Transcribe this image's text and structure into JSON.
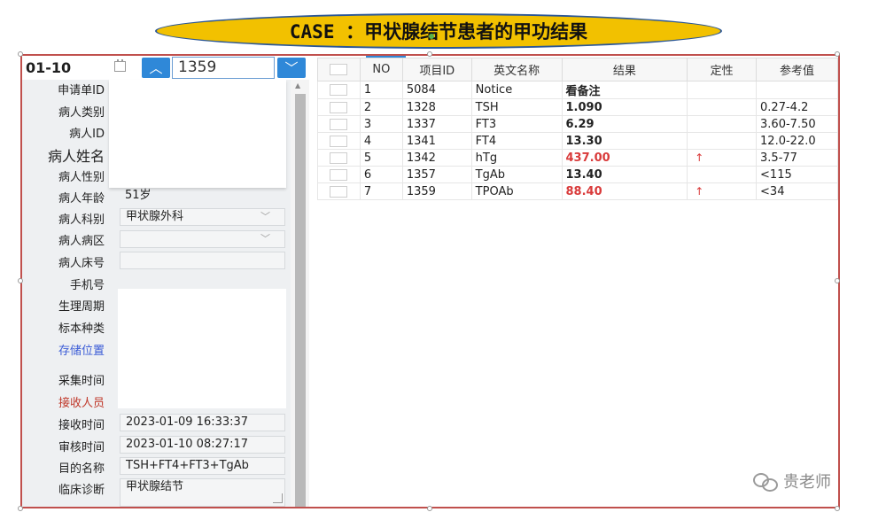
{
  "banner": {
    "title": "CASE ：甲状腺结节患者的甲功结果"
  },
  "toolbar": {
    "sample_no": "01-10",
    "calendar_icon": "calendar-icon",
    "up_icon": "chevron-up-icon",
    "down_icon": "chevron-down-icon",
    "search_value": "1359"
  },
  "patient": {
    "labels": {
      "request_id": "申请单ID",
      "patient_type": "病人类别",
      "patient_id": "病人ID",
      "patient_name": "病人姓名",
      "gender": "病人性别",
      "age": "病人年龄",
      "department": "病人科别",
      "ward": "病人病区",
      "bed": "病人床号",
      "phone": "手机号",
      "cycle": "生理周期",
      "specimen": "标本种类",
      "storage": "存储位置",
      "collect_time": "采集时间",
      "receiver": "接收人员",
      "receive_time": "接收时间",
      "audit_time": "审核时间",
      "purpose": "目的名称",
      "diagnosis": "临床诊断"
    },
    "values": {
      "age": "51岁",
      "department": "甲状腺外科",
      "ward": "",
      "bed": "",
      "receive_time": "2023-01-09 16:33:37",
      "audit_time": "2023-01-10 08:27:17",
      "purpose": "TSH+FT4+FT3+TgAb",
      "diagnosis": "甲状腺结节"
    }
  },
  "results": {
    "headers": [
      "NO",
      "项目ID",
      "英文名称",
      "结果",
      "定性",
      "参考值"
    ],
    "rows": [
      {
        "no": "1",
        "item_id": "5084",
        "name": "Notice",
        "result": "看备注",
        "flag": "",
        "ref": "",
        "high": false
      },
      {
        "no": "2",
        "item_id": "1328",
        "name": "TSH",
        "result": "1.090",
        "flag": "",
        "ref": "0.27-4.2",
        "high": false
      },
      {
        "no": "3",
        "item_id": "1337",
        "name": "FT3",
        "result": "6.29",
        "flag": "",
        "ref": "3.60-7.50",
        "high": false
      },
      {
        "no": "4",
        "item_id": "1341",
        "name": "FT4",
        "result": "13.30",
        "flag": "",
        "ref": "12.0-22.0",
        "high": false
      },
      {
        "no": "5",
        "item_id": "1342",
        "name": "hTg",
        "result": "437.00",
        "flag": "↑",
        "ref": "3.5-77",
        "high": true
      },
      {
        "no": "6",
        "item_id": "1357",
        "name": "TgAb",
        "result": "13.40",
        "flag": "",
        "ref": "<115",
        "high": false
      },
      {
        "no": "7",
        "item_id": "1359",
        "name": "TPOAb",
        "result": "88.40",
        "flag": "↑",
        "ref": "<34",
        "high": true
      }
    ],
    "colors": {
      "high": "#d93a3a",
      "accent": "#2f88d8"
    }
  },
  "watermark": {
    "text": "贵老师",
    "icon": "wechat-icon"
  }
}
